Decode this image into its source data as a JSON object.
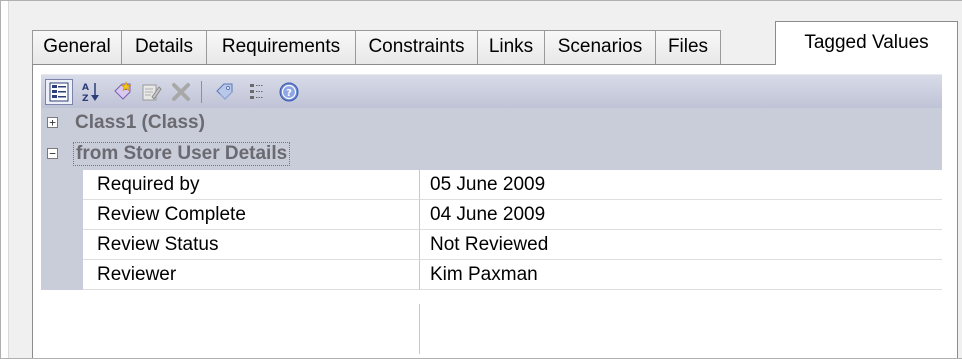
{
  "tabs": [
    {
      "label": "General"
    },
    {
      "label": "Details"
    },
    {
      "label": "Requirements"
    },
    {
      "label": "Constraints"
    },
    {
      "label": "Links"
    },
    {
      "label": "Scenarios"
    },
    {
      "label": "Files"
    },
    {
      "label": "Tagged Values",
      "active": true
    }
  ],
  "toolbar": {
    "buttons": [
      {
        "icon": "categorized-view-icon"
      },
      {
        "icon": "sort-alphabetical-icon"
      },
      {
        "icon": "new-tag-icon"
      },
      {
        "icon": "edit-tag-icon"
      },
      {
        "icon": "delete-icon"
      },
      {
        "icon": "tag-icon"
      },
      {
        "icon": "show-duplicates-icon"
      },
      {
        "icon": "help-icon"
      }
    ]
  },
  "grid": {
    "categories": [
      {
        "label": "Class1 (Class)",
        "expanded": false
      },
      {
        "label": "from Store User Details",
        "expanded": true
      }
    ],
    "rows": [
      {
        "name": "Required by",
        "value": "05 June 2009"
      },
      {
        "name": "Review Complete",
        "value": "04 June 2009"
      },
      {
        "name": "Review Status",
        "value": "Not Reviewed"
      },
      {
        "name": "Reviewer",
        "value": "Kim Paxman"
      }
    ]
  }
}
